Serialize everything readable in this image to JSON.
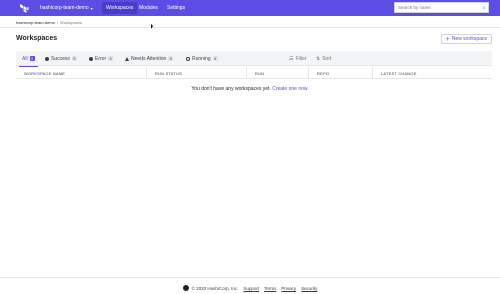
{
  "topnav": {
    "org": "hashicorp-team-demo",
    "tabs": [
      "Workspaces",
      "Modules",
      "Settings"
    ],
    "help": "?"
  },
  "breadcrumb": {
    "root": "hashicorp-team-demo",
    "separator": "/",
    "current": "Workspaces"
  },
  "header": {
    "title": "Workspaces",
    "new_button": "New workspace"
  },
  "filters": {
    "tabs": [
      {
        "label": "All",
        "count": "0"
      },
      {
        "label": "Success",
        "count": "0"
      },
      {
        "label": "Error",
        "count": "0"
      },
      {
        "label": "Needs Attention",
        "count": "0"
      },
      {
        "label": "Running",
        "count": "0"
      }
    ],
    "filter_label": "Filter",
    "sort_label": "Sort",
    "search_placeholder": "Search by name"
  },
  "table": {
    "columns": [
      "WORKSPACE NAME",
      "RUN STATUS",
      "RUN",
      "REPO",
      "LATEST CHANGE"
    ]
  },
  "empty_state": {
    "text": "You don't have any workspaces yet.",
    "link": "Create one now."
  },
  "footer": {
    "copyright": "© 2020 HashiCorp, Inc.",
    "links": [
      "Support",
      "Terms",
      "Privacy",
      "Security"
    ]
  },
  "colors": {
    "brand": "#5c4ee5",
    "nav_active": "#4a3cc9"
  }
}
